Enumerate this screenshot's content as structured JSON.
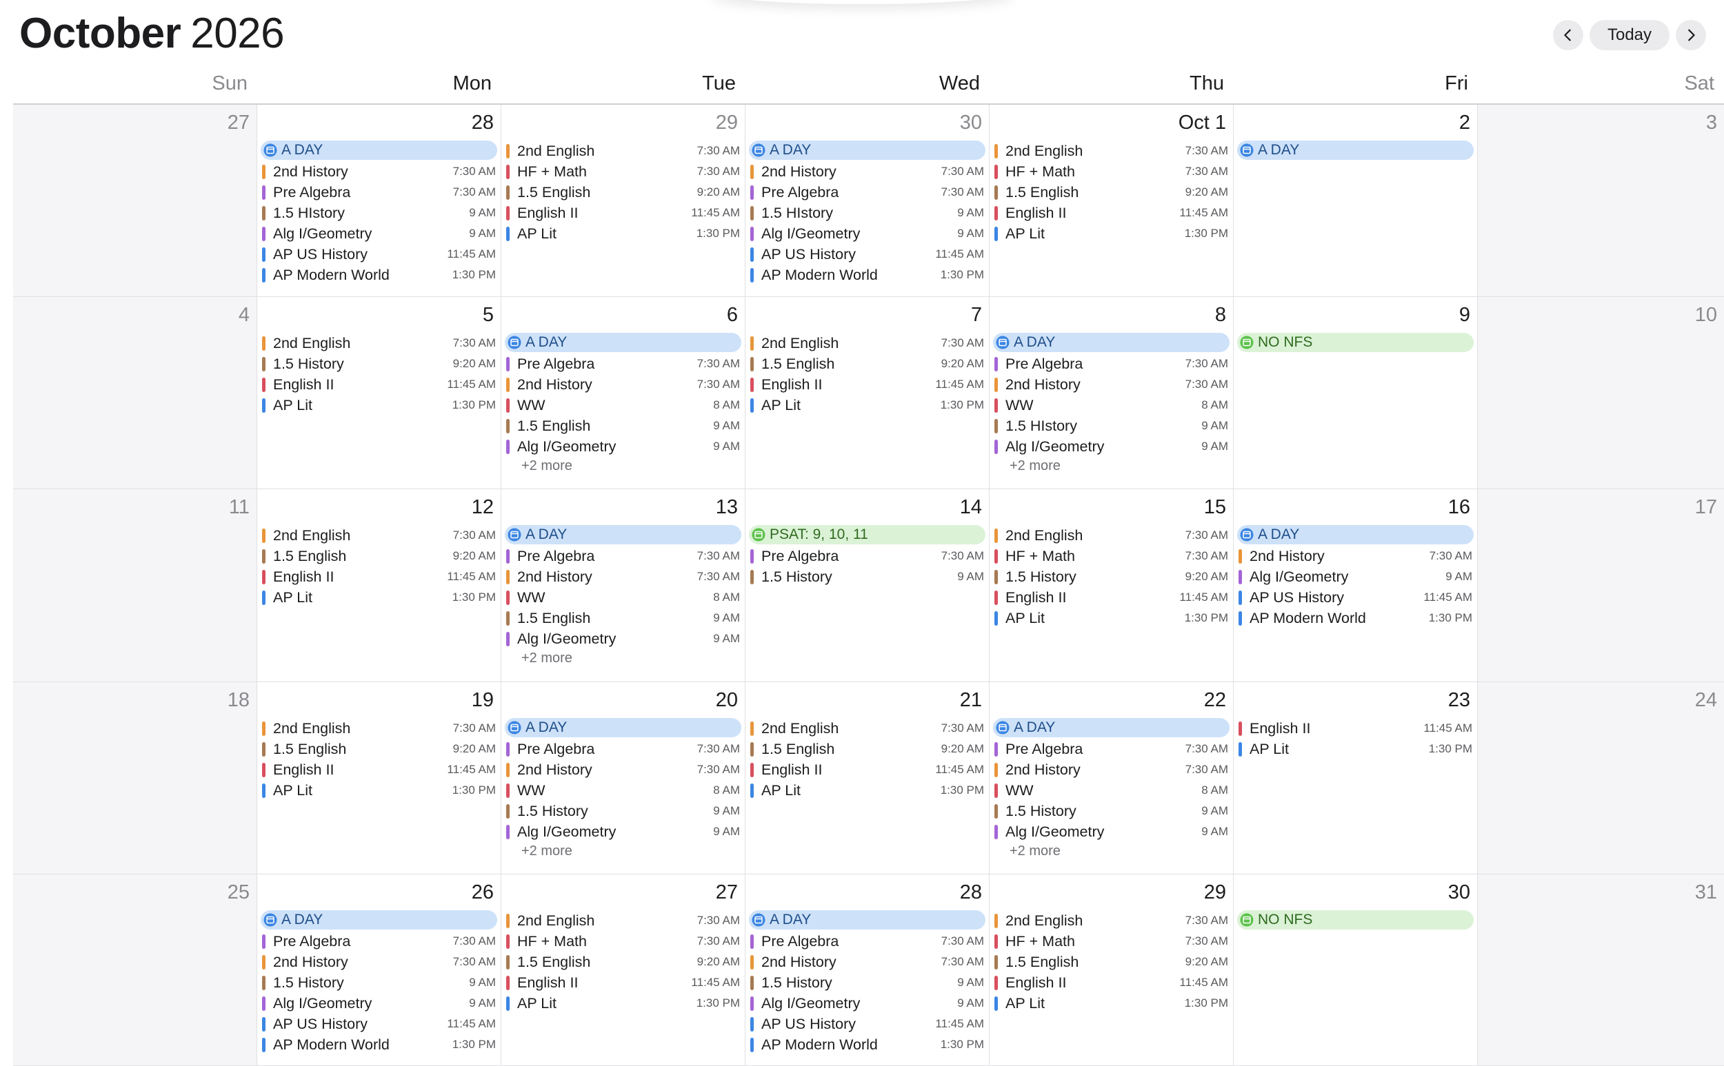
{
  "header": {
    "month": "October",
    "year": "2026",
    "today_label": "Today",
    "prev_icon": "chevron-left-icon",
    "next_icon": "chevron-right-icon"
  },
  "weekdays": [
    "Sun",
    "Mon",
    "Tue",
    "Wed",
    "Thu",
    "Fri",
    "Sat"
  ],
  "colors": {
    "orange": "#e9953a",
    "purple": "#a464d6",
    "brown": "#a77a52",
    "blue": "#3b86e3",
    "red": "#d84f5e",
    "allday_blue_bg": "#cde1f9",
    "allday_green_bg": "#dbf2d6"
  },
  "weeks": [
    {
      "days": [
        {
          "date": "27",
          "weekend": true,
          "events": []
        },
        {
          "date": "28",
          "allday": [
            {
              "title": "A DAY",
              "color": "blue"
            }
          ],
          "events": [
            {
              "title": "2nd History",
              "time": "7:30 AM",
              "color": "orange"
            },
            {
              "title": "Pre Algebra",
              "time": "7:30 AM",
              "color": "purple"
            },
            {
              "title": "1.5 HIstory",
              "time": "9 AM",
              "color": "brown"
            },
            {
              "title": "Alg I/Geometry",
              "time": "9 AM",
              "color": "purple"
            },
            {
              "title": "AP US History",
              "time": "11:45 AM",
              "color": "blue"
            },
            {
              "title": "AP Modern World",
              "time": "1:30 PM",
              "color": "blue"
            }
          ]
        },
        {
          "date": "29",
          "outside": true,
          "events": [
            {
              "title": "2nd English",
              "time": "7:30 AM",
              "color": "orange"
            },
            {
              "title": "HF + Math",
              "time": "7:30 AM",
              "color": "red"
            },
            {
              "title": "1.5 English",
              "time": "9:20 AM",
              "color": "brown"
            },
            {
              "title": "English II",
              "time": "11:45 AM",
              "color": "red"
            },
            {
              "title": "AP Lit",
              "time": "1:30 PM",
              "color": "blue"
            }
          ]
        },
        {
          "date": "30",
          "outside": true,
          "allday": [
            {
              "title": "A DAY",
              "color": "blue"
            }
          ],
          "events": [
            {
              "title": "2nd History",
              "time": "7:30 AM",
              "color": "orange"
            },
            {
              "title": "Pre Algebra",
              "time": "7:30 AM",
              "color": "purple"
            },
            {
              "title": "1.5 HIstory",
              "time": "9 AM",
              "color": "brown"
            },
            {
              "title": "Alg I/Geometry",
              "time": "9 AM",
              "color": "purple"
            },
            {
              "title": "AP US History",
              "time": "11:45 AM",
              "color": "blue"
            },
            {
              "title": "AP Modern World",
              "time": "1:30 PM",
              "color": "blue"
            }
          ]
        },
        {
          "date": "Oct 1",
          "events": [
            {
              "title": "2nd English",
              "time": "7:30 AM",
              "color": "orange"
            },
            {
              "title": "HF + Math",
              "time": "7:30 AM",
              "color": "red"
            },
            {
              "title": "1.5 English",
              "time": "9:20 AM",
              "color": "brown"
            },
            {
              "title": "English II",
              "time": "11:45 AM",
              "color": "red"
            },
            {
              "title": "AP Lit",
              "time": "1:30 PM",
              "color": "blue"
            }
          ]
        },
        {
          "date": "2",
          "allday": [
            {
              "title": "A DAY",
              "color": "blue"
            }
          ],
          "events": []
        },
        {
          "date": "3",
          "weekend": true,
          "events": []
        }
      ]
    },
    {
      "days": [
        {
          "date": "4",
          "weekend": true,
          "events": []
        },
        {
          "date": "5",
          "events": [
            {
              "title": "2nd English",
              "time": "7:30 AM",
              "color": "orange"
            },
            {
              "title": "1.5 History",
              "time": "9:20 AM",
              "color": "brown"
            },
            {
              "title": "English II",
              "time": "11:45 AM",
              "color": "red"
            },
            {
              "title": "AP Lit",
              "time": "1:30 PM",
              "color": "blue"
            }
          ]
        },
        {
          "date": "6",
          "allday": [
            {
              "title": "A DAY",
              "color": "blue"
            }
          ],
          "events": [
            {
              "title": "Pre Algebra",
              "time": "7:30 AM",
              "color": "purple"
            },
            {
              "title": "2nd History",
              "time": "7:30 AM",
              "color": "orange"
            },
            {
              "title": "WW",
              "time": "8 AM",
              "color": "red"
            },
            {
              "title": "1.5 English",
              "time": "9 AM",
              "color": "brown"
            },
            {
              "title": "Alg I/Geometry",
              "time": "9 AM",
              "color": "purple"
            }
          ],
          "more": "+2 more"
        },
        {
          "date": "7",
          "events": [
            {
              "title": "2nd English",
              "time": "7:30 AM",
              "color": "orange"
            },
            {
              "title": "1.5 English",
              "time": "9:20 AM",
              "color": "brown"
            },
            {
              "title": "English II",
              "time": "11:45 AM",
              "color": "red"
            },
            {
              "title": "AP Lit",
              "time": "1:30 PM",
              "color": "blue"
            }
          ]
        },
        {
          "date": "8",
          "allday": [
            {
              "title": "A DAY",
              "color": "blue"
            }
          ],
          "events": [
            {
              "title": "Pre Algebra",
              "time": "7:30 AM",
              "color": "purple"
            },
            {
              "title": "2nd History",
              "time": "7:30 AM",
              "color": "orange"
            },
            {
              "title": "WW",
              "time": "8 AM",
              "color": "red"
            },
            {
              "title": "1.5 HIstory",
              "time": "9 AM",
              "color": "brown"
            },
            {
              "title": "Alg I/Geometry",
              "time": "9 AM",
              "color": "purple"
            }
          ],
          "more": "+2 more"
        },
        {
          "date": "9",
          "allday": [
            {
              "title": "NO NFS",
              "color": "green"
            }
          ],
          "events": []
        },
        {
          "date": "10",
          "weekend": true,
          "events": []
        }
      ]
    },
    {
      "days": [
        {
          "date": "11",
          "weekend": true,
          "events": []
        },
        {
          "date": "12",
          "events": [
            {
              "title": "2nd English",
              "time": "7:30 AM",
              "color": "orange"
            },
            {
              "title": "1.5 English",
              "time": "9:20 AM",
              "color": "brown"
            },
            {
              "title": "English II",
              "time": "11:45 AM",
              "color": "red"
            },
            {
              "title": "AP Lit",
              "time": "1:30 PM",
              "color": "blue"
            }
          ]
        },
        {
          "date": "13",
          "allday": [
            {
              "title": "A DAY",
              "color": "blue"
            }
          ],
          "events": [
            {
              "title": "Pre Algebra",
              "time": "7:30 AM",
              "color": "purple"
            },
            {
              "title": "2nd History",
              "time": "7:30 AM",
              "color": "orange"
            },
            {
              "title": "WW",
              "time": "8 AM",
              "color": "red"
            },
            {
              "title": "1.5 English",
              "time": "9 AM",
              "color": "brown"
            },
            {
              "title": "Alg I/Geometry",
              "time": "9 AM",
              "color": "purple"
            }
          ],
          "more": "+2 more"
        },
        {
          "date": "14",
          "allday": [
            {
              "title": "PSAT: 9, 10, 11",
              "color": "green"
            }
          ],
          "events": [
            {
              "title": "Pre Algebra",
              "time": "7:30 AM",
              "color": "purple"
            },
            {
              "title": "1.5 History",
              "time": "9 AM",
              "color": "brown"
            }
          ]
        },
        {
          "date": "15",
          "events": [
            {
              "title": "2nd English",
              "time": "7:30 AM",
              "color": "orange"
            },
            {
              "title": "HF + Math",
              "time": "7:30 AM",
              "color": "red"
            },
            {
              "title": "1.5 History",
              "time": "9:20 AM",
              "color": "brown"
            },
            {
              "title": "English II",
              "time": "11:45 AM",
              "color": "red"
            },
            {
              "title": "AP Lit",
              "time": "1:30 PM",
              "color": "blue"
            }
          ]
        },
        {
          "date": "16",
          "allday": [
            {
              "title": "A DAY",
              "color": "blue"
            }
          ],
          "events": [
            {
              "title": "2nd History",
              "time": "7:30 AM",
              "color": "orange"
            },
            {
              "title": "Alg I/Geometry",
              "time": "9 AM",
              "color": "purple"
            },
            {
              "title": "AP US History",
              "time": "11:45 AM",
              "color": "blue"
            },
            {
              "title": "AP Modern World",
              "time": "1:30 PM",
              "color": "blue"
            }
          ]
        },
        {
          "date": "17",
          "weekend": true,
          "events": []
        }
      ]
    },
    {
      "days": [
        {
          "date": "18",
          "weekend": true,
          "events": []
        },
        {
          "date": "19",
          "events": [
            {
              "title": "2nd English",
              "time": "7:30 AM",
              "color": "orange"
            },
            {
              "title": "1.5 English",
              "time": "9:20 AM",
              "color": "brown"
            },
            {
              "title": "English II",
              "time": "11:45 AM",
              "color": "red"
            },
            {
              "title": "AP Lit",
              "time": "1:30 PM",
              "color": "blue"
            }
          ]
        },
        {
          "date": "20",
          "allday": [
            {
              "title": "A DAY",
              "color": "blue"
            }
          ],
          "events": [
            {
              "title": "Pre Algebra",
              "time": "7:30 AM",
              "color": "purple"
            },
            {
              "title": "2nd History",
              "time": "7:30 AM",
              "color": "orange"
            },
            {
              "title": "WW",
              "time": "8 AM",
              "color": "red"
            },
            {
              "title": "1.5 History",
              "time": "9 AM",
              "color": "brown"
            },
            {
              "title": "Alg I/Geometry",
              "time": "9 AM",
              "color": "purple"
            }
          ],
          "more": "+2 more"
        },
        {
          "date": "21",
          "events": [
            {
              "title": "2nd English",
              "time": "7:30 AM",
              "color": "orange"
            },
            {
              "title": "1.5 English",
              "time": "9:20 AM",
              "color": "brown"
            },
            {
              "title": "English II",
              "time": "11:45 AM",
              "color": "red"
            },
            {
              "title": "AP Lit",
              "time": "1:30 PM",
              "color": "blue"
            }
          ]
        },
        {
          "date": "22",
          "allday": [
            {
              "title": "A DAY",
              "color": "blue"
            }
          ],
          "events": [
            {
              "title": "Pre Algebra",
              "time": "7:30 AM",
              "color": "purple"
            },
            {
              "title": "2nd History",
              "time": "7:30 AM",
              "color": "orange"
            },
            {
              "title": "WW",
              "time": "8 AM",
              "color": "red"
            },
            {
              "title": "1.5 History",
              "time": "9 AM",
              "color": "brown"
            },
            {
              "title": "Alg I/Geometry",
              "time": "9 AM",
              "color": "purple"
            }
          ],
          "more": "+2 more"
        },
        {
          "date": "23",
          "events": [
            {
              "title": "English II",
              "time": "11:45 AM",
              "color": "red"
            },
            {
              "title": "AP Lit",
              "time": "1:30 PM",
              "color": "blue"
            }
          ]
        },
        {
          "date": "24",
          "weekend": true,
          "events": []
        }
      ]
    },
    {
      "days": [
        {
          "date": "25",
          "weekend": true,
          "events": []
        },
        {
          "date": "26",
          "allday": [
            {
              "title": "A DAY",
              "color": "blue"
            }
          ],
          "events": [
            {
              "title": "Pre Algebra",
              "time": "7:30 AM",
              "color": "purple"
            },
            {
              "title": "2nd History",
              "time": "7:30 AM",
              "color": "orange"
            },
            {
              "title": "1.5 History",
              "time": "9 AM",
              "color": "brown"
            },
            {
              "title": "Alg I/Geometry",
              "time": "9 AM",
              "color": "purple"
            },
            {
              "title": "AP US History",
              "time": "11:45 AM",
              "color": "blue"
            },
            {
              "title": "AP Modern World",
              "time": "1:30 PM",
              "color": "blue"
            }
          ]
        },
        {
          "date": "27",
          "events": [
            {
              "title": "2nd English",
              "time": "7:30 AM",
              "color": "orange"
            },
            {
              "title": "HF + Math",
              "time": "7:30 AM",
              "color": "red"
            },
            {
              "title": "1.5 English",
              "time": "9:20 AM",
              "color": "brown"
            },
            {
              "title": "English II",
              "time": "11:45 AM",
              "color": "red"
            },
            {
              "title": "AP Lit",
              "time": "1:30 PM",
              "color": "blue"
            }
          ]
        },
        {
          "date": "28",
          "allday": [
            {
              "title": "A DAY",
              "color": "blue"
            }
          ],
          "events": [
            {
              "title": "Pre Algebra",
              "time": "7:30 AM",
              "color": "purple"
            },
            {
              "title": "2nd History",
              "time": "7:30 AM",
              "color": "orange"
            },
            {
              "title": "1.5 History",
              "time": "9 AM",
              "color": "brown"
            },
            {
              "title": "Alg I/Geometry",
              "time": "9 AM",
              "color": "purple"
            },
            {
              "title": "AP US History",
              "time": "11:45 AM",
              "color": "blue"
            },
            {
              "title": "AP Modern World",
              "time": "1:30 PM",
              "color": "blue"
            }
          ]
        },
        {
          "date": "29",
          "events": [
            {
              "title": "2nd English",
              "time": "7:30 AM",
              "color": "orange"
            },
            {
              "title": "HF + Math",
              "time": "7:30 AM",
              "color": "red"
            },
            {
              "title": "1.5 English",
              "time": "9:20 AM",
              "color": "brown"
            },
            {
              "title": "English II",
              "time": "11:45 AM",
              "color": "red"
            },
            {
              "title": "AP Lit",
              "time": "1:30 PM",
              "color": "blue"
            }
          ]
        },
        {
          "date": "30",
          "allday": [
            {
              "title": "NO NFS",
              "color": "green"
            }
          ],
          "events": []
        },
        {
          "date": "31",
          "weekend": true,
          "events": []
        }
      ]
    }
  ]
}
